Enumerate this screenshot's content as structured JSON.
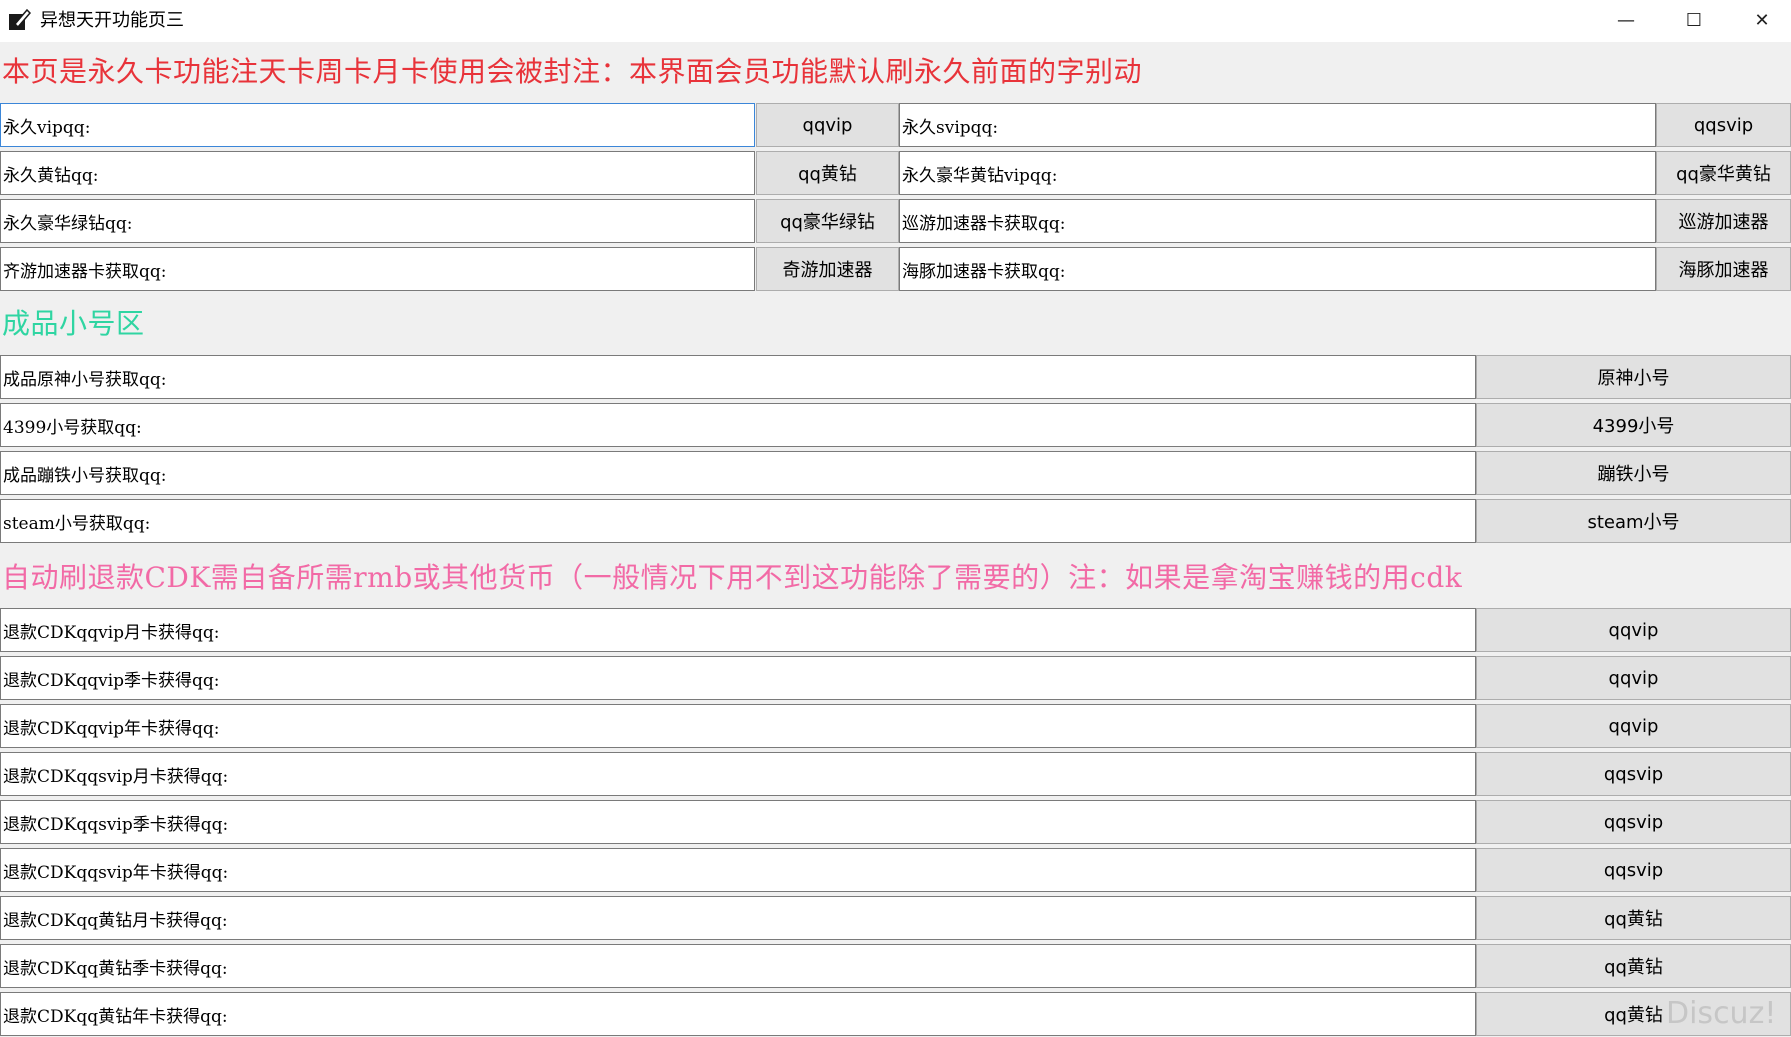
{
  "window": {
    "title": "异想天开功能页三",
    "minimize_glyph": "—",
    "maximize_glyph": "☐",
    "close_glyph": "✕",
    "app_icon": "pen-icon"
  },
  "headings": {
    "notice": "本页是永久卡功能注天卡周卡月卡使用会被封注：本界面会员功能默认刷永久前面的字别动",
    "accounts": "成品小号区",
    "refund": "自动刷退款CDK需自备所需rmb或其他货币（一般情况下用不到这功能除了需要的）注：如果是拿淘宝赚钱的用cdk"
  },
  "permanent": [
    {
      "left_value": "永久vipqq:",
      "left_button": "qqvip",
      "right_value": "永久svipqq:",
      "right_button": "qqsvip"
    },
    {
      "left_value": "永久黄钻qq:",
      "left_button": "qq黄钻",
      "right_value": "永久豪华黄钻vipqq:",
      "right_button": "qq豪华黄钻"
    },
    {
      "left_value": "永久豪华绿钻qq:",
      "left_button": "qq豪华绿钻",
      "right_value": "巡游加速器卡获取qq:",
      "right_button": "巡游加速器"
    },
    {
      "left_value": "齐游加速器卡获取qq:",
      "left_button": "奇游加速器",
      "right_value": "海豚加速器卡获取qq:",
      "right_button": "海豚加速器"
    }
  ],
  "accounts": [
    {
      "value": "成品原神小号获取qq:",
      "button": "原神小号"
    },
    {
      "value": "4399小号获取qq:",
      "button": "4399小号"
    },
    {
      "value": "成品蹦铁小号获取qq:",
      "button": "蹦铁小号"
    },
    {
      "value": "steam小号获取qq:",
      "button": "steam小号"
    }
  ],
  "refund": [
    {
      "value": "退款CDKqqvip月卡获得qq:",
      "button": "qqvip"
    },
    {
      "value": "退款CDKqqvip季卡获得qq:",
      "button": "qqvip"
    },
    {
      "value": "退款CDKqqvip年卡获得qq:",
      "button": "qqvip"
    },
    {
      "value": "退款CDKqqsvip月卡获得qq:",
      "button": "qqsvip"
    },
    {
      "value": "退款CDKqqsvip季卡获得qq:",
      "button": "qqsvip"
    },
    {
      "value": "退款CDKqqsvip年卡获得qq:",
      "button": "qqsvip"
    },
    {
      "value": "退款CDKqq黄钻月卡获得qq:",
      "button": "qq黄钻"
    },
    {
      "value": "退款CDKqq黄钻季卡获得qq:",
      "button": "qq黄钻"
    },
    {
      "value": "退款CDKqq黄钻年卡获得qq:",
      "button": "qq黄钻"
    }
  ],
  "watermark": "Discuz!",
  "colors": {
    "notice": "#e8333a",
    "accounts_heading": "#2fd5a2",
    "refund_heading": "#f26aa6",
    "focus_border": "#3b86d8"
  }
}
